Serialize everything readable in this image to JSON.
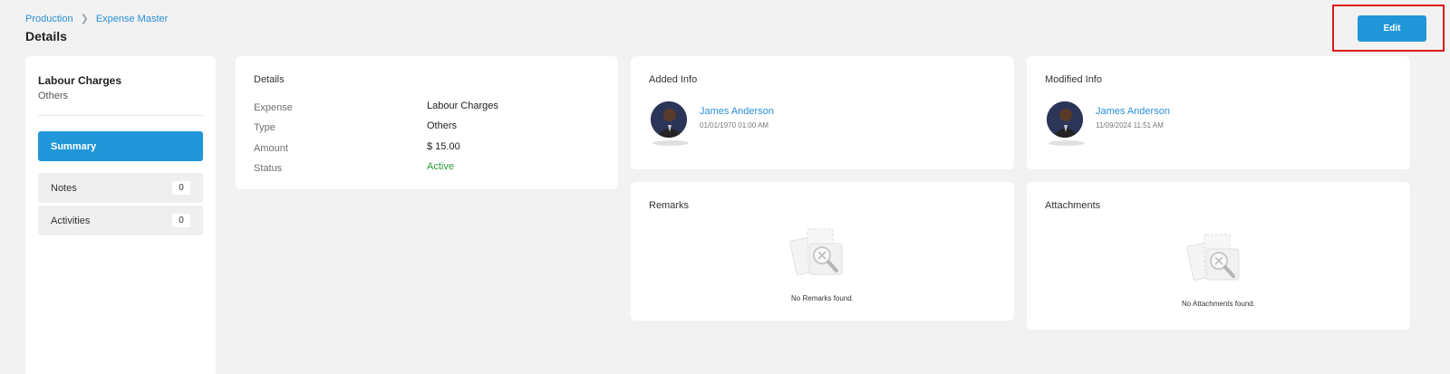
{
  "breadcrumb": {
    "items": [
      "Production",
      "Expense Master"
    ]
  },
  "page_title": "Details",
  "toolbar": {
    "edit_label": "Edit"
  },
  "colors": {
    "accent": "#2196d8",
    "link": "#2a8fd6",
    "active": "#2e9b3a",
    "highlight_border": "#e0161b"
  },
  "left_panel": {
    "title": "Labour Charges",
    "subtitle": "Others",
    "nav": {
      "summary": "Summary",
      "notes": {
        "label": "Notes",
        "count": "0"
      },
      "activities": {
        "label": "Activities",
        "count": "0"
      }
    }
  },
  "details": {
    "title": "Details",
    "rows": [
      {
        "label": "Expense",
        "value": "Labour Charges"
      },
      {
        "label": "Type",
        "value": "Others"
      },
      {
        "label": "Amount",
        "value": "$ 15.00"
      },
      {
        "label": "Status",
        "value": "Active"
      }
    ]
  },
  "added_info": {
    "title": "Added Info",
    "name": "James Anderson",
    "time": "01/01/1970 01:00 AM"
  },
  "modified_info": {
    "title": "Modified Info",
    "name": "James Anderson",
    "time": "11/09/2024 11:51 AM"
  },
  "remarks": {
    "title": "Remarks",
    "empty": "No Remarks found."
  },
  "attachments": {
    "title": "Attachments",
    "empty": "No Attachments found."
  },
  "icons": [
    "chevron-right-icon",
    "avatar",
    "empty-search-icon"
  ]
}
